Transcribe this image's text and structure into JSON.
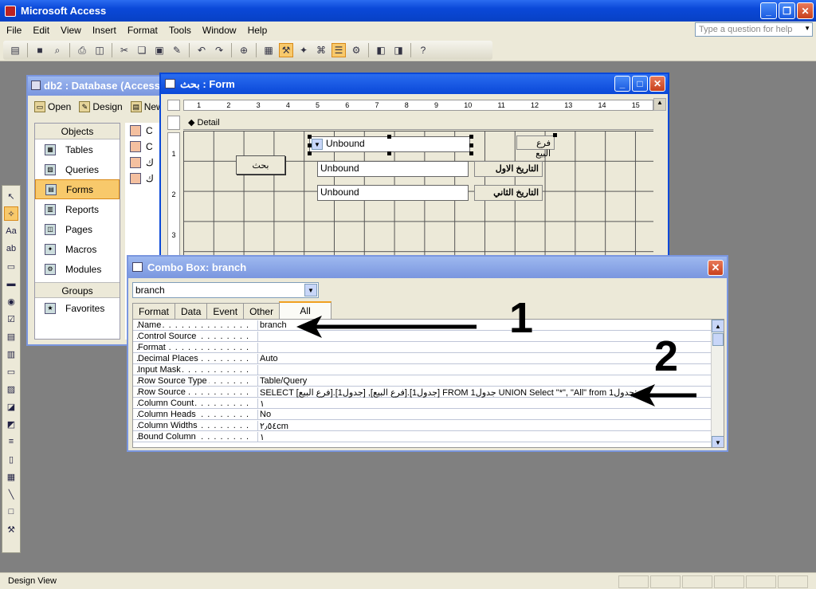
{
  "app": {
    "title": "Microsoft Access"
  },
  "menu": [
    "File",
    "Edit",
    "View",
    "Insert",
    "Format",
    "Tools",
    "Window",
    "Help"
  ],
  "ask_placeholder": "Type a question for help",
  "db_window": {
    "title": "db2 : Database (Access",
    "toolbar": {
      "open": "Open",
      "design": "Design",
      "new": "New"
    },
    "objects_header": "Objects",
    "objects": [
      "Tables",
      "Queries",
      "Forms",
      "Reports",
      "Pages",
      "Macros",
      "Modules"
    ],
    "selected_object": "Forms",
    "groups_header": "Groups",
    "groups": [
      "Favorites"
    ],
    "list_items": [
      "C",
      "C",
      "ك",
      "ك"
    ]
  },
  "form_window": {
    "title": "بحث : Form",
    "section": "Detail",
    "ruler_marks": [
      "1",
      "2",
      "3",
      "4",
      "5",
      "6",
      "7",
      "8",
      "9",
      "10",
      "11",
      "12",
      "13",
      "14",
      "15"
    ],
    "vruler_marks": [
      "1",
      "2",
      "3"
    ],
    "combo_text": "Unbound",
    "textbox1": "Unbound",
    "textbox2": "Unbound",
    "label_branch": "فرع البيع",
    "label_date1": "التاريخ الاول",
    "label_date2": "التاريخ الثاني",
    "search_button": "بحث"
  },
  "property_sheet": {
    "title": "Combo Box: branch",
    "selected_object": "branch",
    "tabs": [
      "Format",
      "Data",
      "Event",
      "Other",
      "All"
    ],
    "active_tab": "All",
    "rows": [
      {
        "name": "Name",
        "value": "branch"
      },
      {
        "name": "Control Source",
        "value": ""
      },
      {
        "name": "Format",
        "value": ""
      },
      {
        "name": "Decimal Places",
        "value": "Auto"
      },
      {
        "name": "Input Mask",
        "value": ""
      },
      {
        "name": "Row Source Type",
        "value": "Table/Query"
      },
      {
        "name": "Row Source",
        "value": "SELECT [فرع البيع].[جدول1] ,[فرع البيع].[جدول1] FROM جدول1 UNION Select \"*\", \"All\" from جدول1;"
      },
      {
        "name": "Column Count",
        "value": "١"
      },
      {
        "name": "Column Heads",
        "value": "No"
      },
      {
        "name": "Column Widths",
        "value": "٢٫٥٤cm"
      },
      {
        "name": "Bound Column",
        "value": "١"
      }
    ]
  },
  "annotations": {
    "one": "1",
    "two": "2"
  },
  "status": "Design View"
}
